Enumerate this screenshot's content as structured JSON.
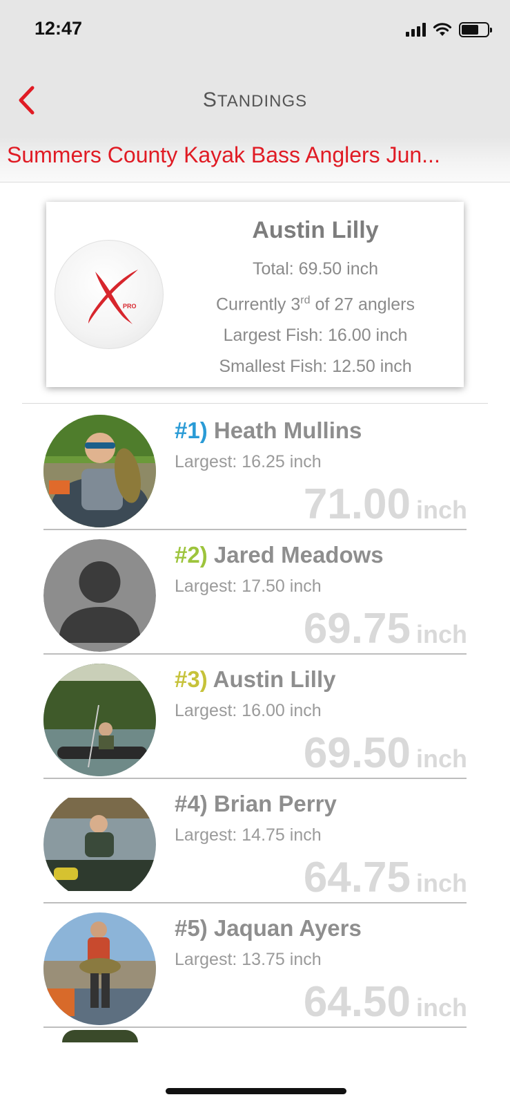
{
  "status_bar": {
    "time": "12:47"
  },
  "nav": {
    "title_first_letter": "S",
    "title_rest": "TANDINGS"
  },
  "event": {
    "title": "Summers County Kayak Bass Anglers Jun..."
  },
  "summary": {
    "name": "Austin Lilly",
    "total": "Total: 69.50 inch",
    "current_prefix": "Currently 3",
    "current_suffix": "rd",
    "current_rest": " of 27 anglers",
    "largest": "Largest Fish:  16.00 inch",
    "smallest": "Smallest Fish:  12.50 inch",
    "logo_label": "PRO"
  },
  "standings": [
    {
      "rank": "#1)",
      "name": "Heath Mullins",
      "largest": "Largest:  16.25 inch",
      "total": "71.00",
      "unit": "inch",
      "rank_color": "#2a9bd6",
      "avatar": "photo-kayak-fish"
    },
    {
      "rank": "#2)",
      "name": "Jared Meadows",
      "largest": "Largest:  17.50 inch",
      "total": "69.75",
      "unit": "inch",
      "rank_color": "#9dc43c",
      "avatar": "default-person"
    },
    {
      "rank": "#3)",
      "name": "Austin Lilly",
      "largest": "Largest:  16.00 inch",
      "total": "69.50",
      "unit": "inch",
      "rank_color": "#c6c23a",
      "avatar": "photo-river-kayak"
    },
    {
      "rank": "#4)",
      "name": "Brian Perry",
      "largest": "Largest:  14.75 inch",
      "total": "64.75",
      "unit": "inch",
      "rank_color": "#8e8e8e",
      "avatar": "photo-lake-angler"
    },
    {
      "rank": "#5)",
      "name": "Jaquan Ayers",
      "largest": "Largest:  13.75 inch",
      "total": "64.50",
      "unit": "inch",
      "rank_color": "#8e8e8e",
      "avatar": "photo-boat-fish"
    }
  ],
  "colors": {
    "accent_red": "#e01b24",
    "nav_bg": "#e6e6e6"
  }
}
